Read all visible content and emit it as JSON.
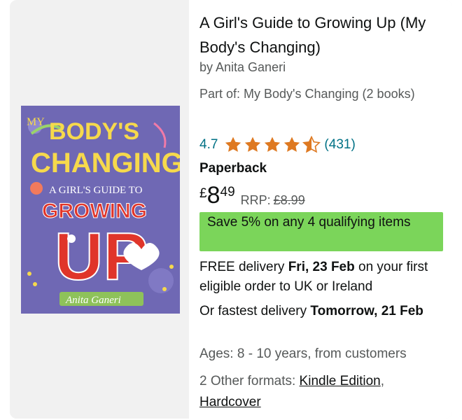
{
  "product": {
    "title": "A Girl's Guide to Growing Up (My Body's Changing)",
    "byline": "by Anita Ganeri",
    "series": "Part of: My Body's Changing (2 books)",
    "rating": "4.7",
    "rating_value": 4.7,
    "review_count": "(431)",
    "format": "Paperback",
    "price_currency": "£",
    "price_whole": "8",
    "price_fraction": "49",
    "rrp_label": "RRP:",
    "rrp_value": "£8.99",
    "promo": "Save 5% on any 4 qualifying items",
    "delivery_prefix": "FREE delivery ",
    "delivery_date": "Fri, 23 Feb",
    "delivery_suffix": " on your first eligible order to UK or Ireland",
    "fastest_prefix": "Or fastest delivery ",
    "fastest_date": "Tomorrow, 21 Feb",
    "ages": "Ages: 8 - 10 years, from customers",
    "other_formats_label": "2 Other formats: ",
    "other_format_1": "Kindle Edition",
    "other_format_sep": ", ",
    "other_format_2": "Hardcover"
  },
  "cover": {
    "line1": "MY BODY'S",
    "line2": "CHANGING",
    "line3": "A GIRL'S GUIDE TO",
    "line4": "GROWING",
    "line5": "UP",
    "author": "Anita Ganeri"
  },
  "colors": {
    "accent_link": "#007185",
    "star": "#de7921",
    "promo_bg": "#7bd55a",
    "cover_bg": "#6f68b4"
  },
  "icons": {
    "star": "star-icon",
    "half_star": "half-star-icon"
  }
}
